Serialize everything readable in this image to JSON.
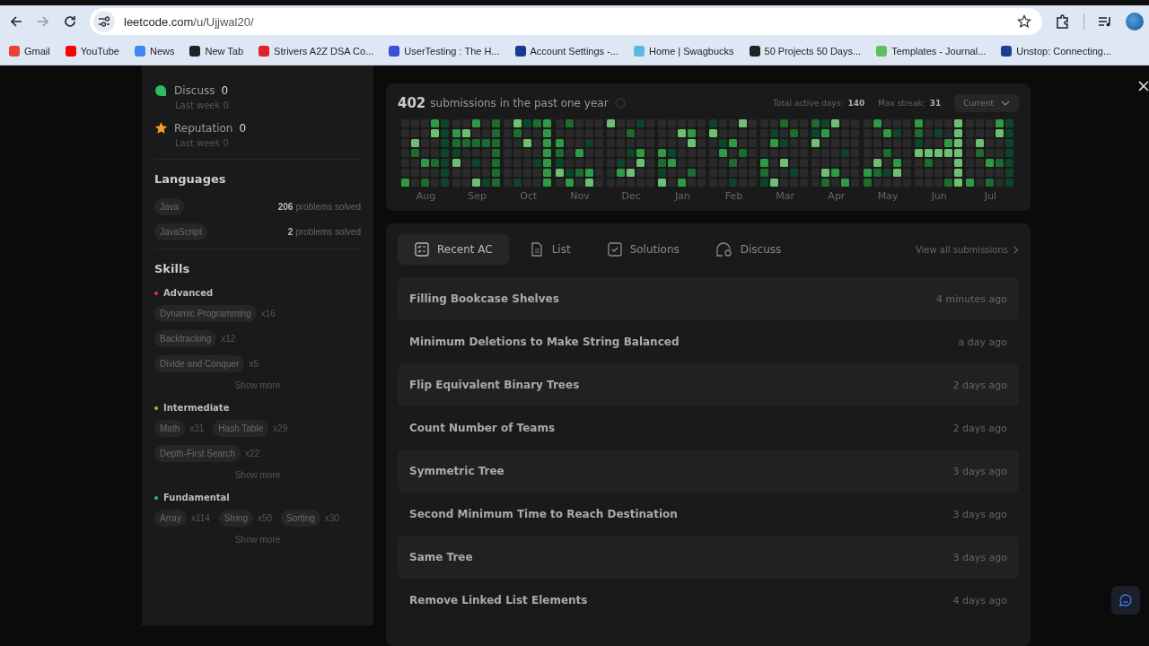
{
  "browser": {
    "url_host": "leetcode.com",
    "url_path": "/u/Ujjwal20/",
    "back_disabled": false,
    "forward_disabled": true
  },
  "bookmarks": [
    {
      "label": "Gmail",
      "color": "#ea4335"
    },
    {
      "label": "YouTube",
      "color": "#ff0000"
    },
    {
      "label": "News",
      "color": "#4285f4"
    },
    {
      "label": "New Tab",
      "color": "#202124"
    },
    {
      "label": "Strivers A2Z DSA Co...",
      "color": "#e0202a"
    },
    {
      "label": "UserTesting : The H...",
      "color": "#3b4fd8"
    },
    {
      "label": "Account Settings -...",
      "color": "#1a3a8f"
    },
    {
      "label": "Home | Swagbucks",
      "color": "#5bb8e0"
    },
    {
      "label": "50 Projects 50 Days...",
      "color": "#202124"
    },
    {
      "label": "Templates - Journal...",
      "color": "#5cc05c"
    },
    {
      "label": "Unstop: Connecting...",
      "color": "#1c3f94"
    }
  ],
  "stats": [
    {
      "label": "Discuss",
      "value": "0",
      "sub": "Last week",
      "sub_value": "0",
      "color": "#2cbb5d"
    },
    {
      "label": "Reputation",
      "value": "0",
      "sub": "Last week",
      "sub_value": "0",
      "color": "#f0a020"
    }
  ],
  "languages": {
    "title": "Languages",
    "items": [
      {
        "name": "Java",
        "count": "206",
        "suffix": "problems solved"
      },
      {
        "name": "JavaScript",
        "count": "2",
        "suffix": "problems solved"
      }
    ]
  },
  "skills": {
    "title": "Skills",
    "groups": [
      {
        "name": "Advanced",
        "color": "#e0353b",
        "rows": [
          [
            {
              "tag": "Dynamic Programming",
              "count": "x16"
            }
          ],
          [
            {
              "tag": "Backtracking",
              "count": "x12"
            }
          ],
          [
            {
              "tag": "Divide and Conquer",
              "count": "x5"
            }
          ]
        ],
        "more": "Show more"
      },
      {
        "name": "Intermediate",
        "color": "#c7b02a",
        "rows": [
          [
            {
              "tag": "Math",
              "count": "x31"
            },
            {
              "tag": "Hash Table",
              "count": "x29"
            }
          ],
          [
            {
              "tag": "Depth-First Search",
              "count": "x22"
            }
          ]
        ],
        "more": "Show more"
      },
      {
        "name": "Fundamental",
        "color": "#2cbb5d",
        "rows": [
          [
            {
              "tag": "Array",
              "count": "x114"
            },
            {
              "tag": "String",
              "count": "x50"
            },
            {
              "tag": "Sorting",
              "count": "x30"
            }
          ]
        ],
        "more": "Show more"
      }
    ]
  },
  "activity": {
    "count": "402",
    "caption": "submissions in the past one year",
    "active_label": "Total active days:",
    "active_value": "140",
    "streak_label": "Max streak:",
    "streak_value": "31",
    "period": "Current",
    "months": [
      "Aug",
      "Sep",
      "Oct",
      "Nov",
      "Dec",
      "Jan",
      "Feb",
      "Mar",
      "Apr",
      "May",
      "Jun",
      "Jul"
    ]
  },
  "tabs": [
    {
      "label": "Recent AC",
      "selected": true
    },
    {
      "label": "List",
      "selected": false
    },
    {
      "label": "Solutions",
      "selected": false
    },
    {
      "label": "Discuss",
      "selected": false
    }
  ],
  "view_all": "View all submissions",
  "submissions": [
    {
      "title": "Filling Bookcase Shelves",
      "time": "4 minutes ago"
    },
    {
      "title": "Minimum Deletions to Make String Balanced",
      "time": "a day ago"
    },
    {
      "title": "Flip Equivalent Binary Trees",
      "time": "2 days ago"
    },
    {
      "title": "Count Number of Teams",
      "time": "2 days ago"
    },
    {
      "title": "Symmetric Tree",
      "time": "3 days ago"
    },
    {
      "title": "Second Minimum Time to Reach Destination",
      "time": "3 days ago"
    },
    {
      "title": "Same Tree",
      "time": "3 days ago"
    },
    {
      "title": "Remove Linked List Elements",
      "time": "4 days ago"
    }
  ]
}
